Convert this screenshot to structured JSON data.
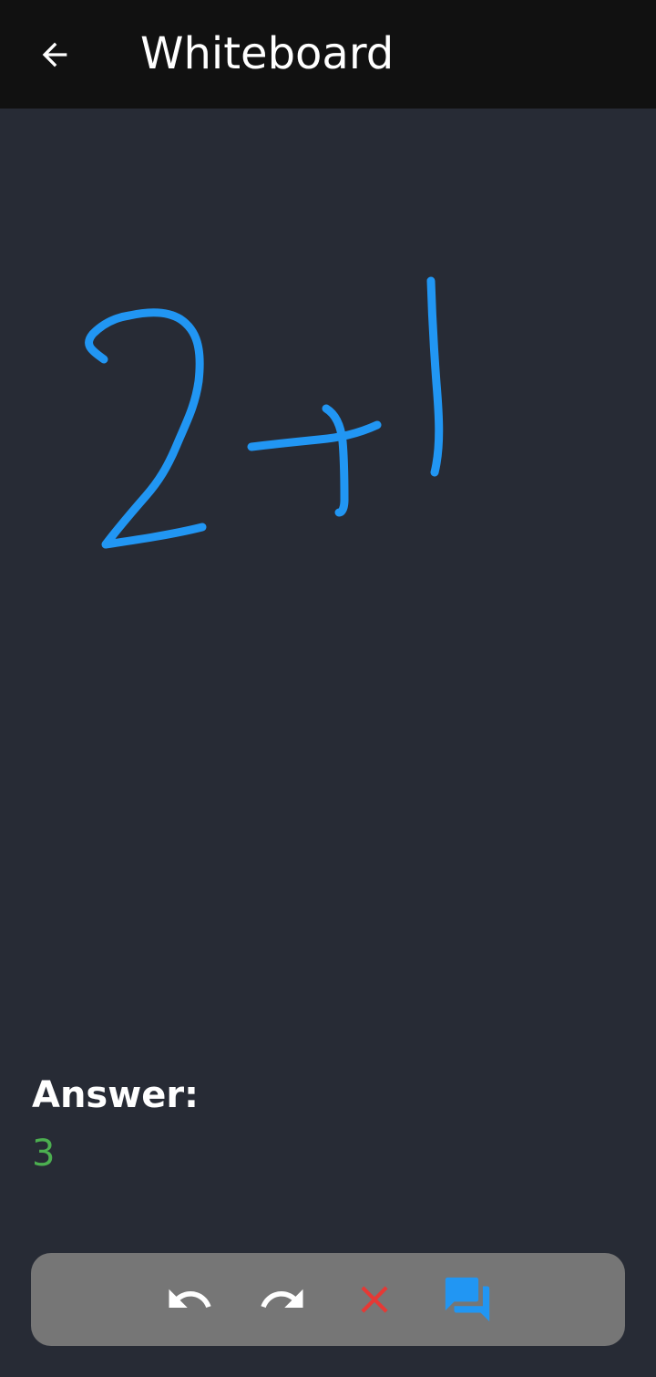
{
  "app_bar": {
    "title": "Whiteboard",
    "back_icon": "arrow-back-icon"
  },
  "whiteboard": {
    "stroke_color": "#2196f3",
    "background_color": "#272b35"
  },
  "answer": {
    "label": "Answer:",
    "value": "3",
    "value_color": "#4caf50"
  },
  "toolbar": {
    "background_color": "#767676",
    "tools": [
      {
        "name": "undo",
        "icon": "undo-icon",
        "color": "#ffffff"
      },
      {
        "name": "redo",
        "icon": "redo-icon",
        "color": "#ffffff"
      },
      {
        "name": "clear",
        "icon": "close-icon",
        "color": "#e53935"
      },
      {
        "name": "ask",
        "icon": "forum-icon",
        "color": "#2196f3"
      }
    ]
  }
}
